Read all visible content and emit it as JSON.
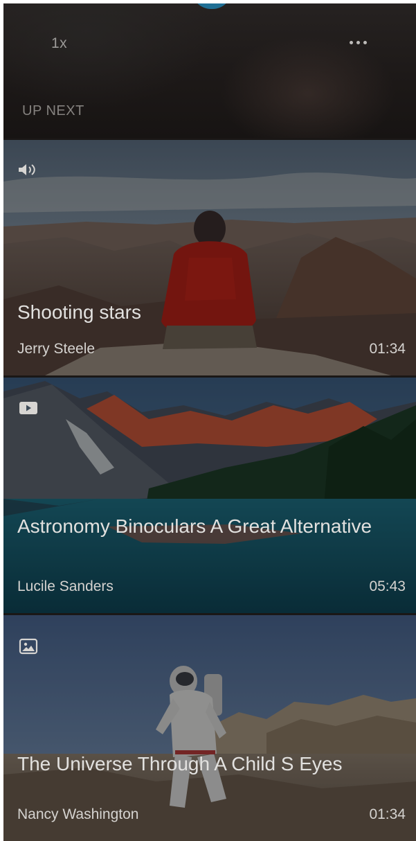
{
  "player": {
    "speed_label": "1x",
    "more_icon": "ellipsis-icon",
    "section_label": "UP NEXT"
  },
  "queue": [
    {
      "type_icon": "audio-icon",
      "title": "Shooting stars",
      "author": "Jerry Steele",
      "duration": "01:34"
    },
    {
      "type_icon": "video-icon",
      "title": "Astronomy Binoculars A Great Alternative",
      "author": "Lucile Sanders",
      "duration": "05:43"
    },
    {
      "type_icon": "image-icon",
      "title": "The Universe Through A Child S Eyes",
      "author": "Nancy Washington",
      "duration": "01:34"
    }
  ],
  "colors": {
    "accent": "#1f6f95",
    "background": "#1a1716"
  }
}
